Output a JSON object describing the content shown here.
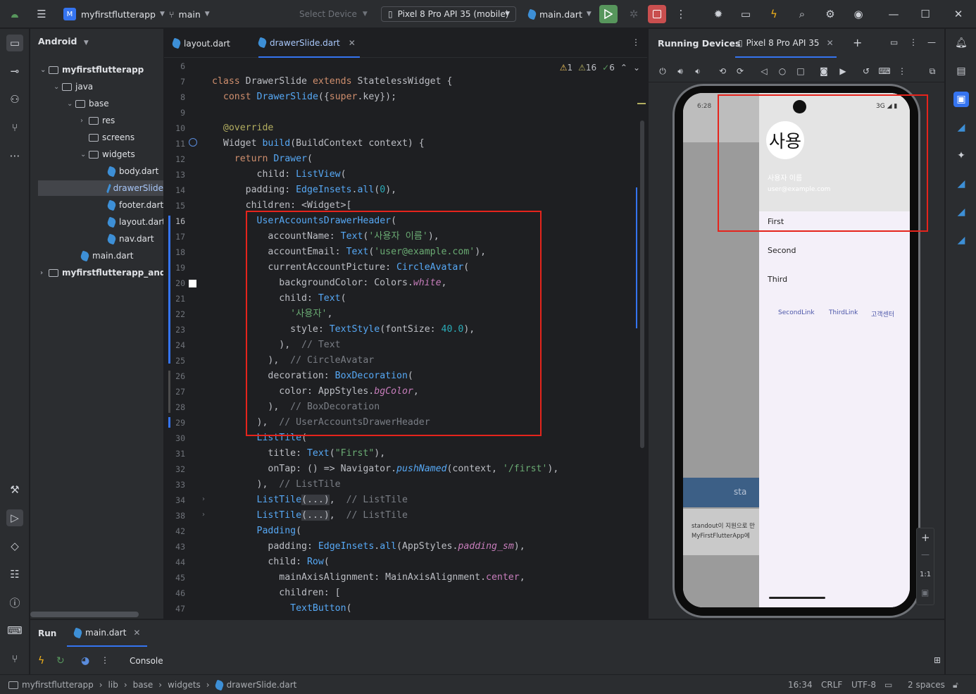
{
  "titlebar": {
    "project": "myfirstflutterapp",
    "project_badge": "M",
    "branch": "main",
    "select_device": "Select Device",
    "device": "Pixel 8 Pro API 35 (mobile)",
    "run_config": "main.dart"
  },
  "project_panel": {
    "header": "Android",
    "tree": [
      {
        "label": "myfirstflutterapp",
        "bold": true
      },
      {
        "label": "java"
      },
      {
        "label": "base"
      },
      {
        "label": "res"
      },
      {
        "label": "screens"
      },
      {
        "label": "widgets"
      },
      {
        "label": "body.dart"
      },
      {
        "label": "drawerSlide"
      },
      {
        "label": "footer.dart"
      },
      {
        "label": "layout.dart"
      },
      {
        "label": "nav.dart"
      },
      {
        "label": "main.dart"
      },
      {
        "label": "myfirstflutterapp_andro",
        "bold": true
      }
    ]
  },
  "editor": {
    "tabs": [
      {
        "label": "layout.dart"
      },
      {
        "label": "drawerSlide.dart",
        "active": true
      }
    ],
    "indicators": {
      "warnings": "1",
      "weak_warnings": "16",
      "typos": "6"
    },
    "line_numbers": [
      "6",
      "7",
      "8",
      "9",
      "10",
      "11",
      "12",
      "13",
      "14",
      "15",
      "16",
      "17",
      "18",
      "19",
      "20",
      "21",
      "22",
      "23",
      "24",
      "25",
      "26",
      "27",
      "28",
      "29",
      "30",
      "31",
      "32",
      "33",
      "34",
      "38",
      "42",
      "43",
      "44",
      "45",
      "46",
      "47"
    ]
  },
  "devices": {
    "title": "Running Devices",
    "tab": "Pixel 8 Pro API 35",
    "status_time": "6:28",
    "status_net": "3G",
    "avatar_text": "사용",
    "account_name": "사용자 이름",
    "account_email": "user@example.com",
    "menu": [
      "First",
      "Second",
      "Third"
    ],
    "links": [
      "SecondLink",
      "ThirdLink",
      "고객센터"
    ],
    "bg_text_1": "standout이 지원으로 만",
    "bg_text_2": "MyFirstFlutterApp에",
    "bg_banner": "sta",
    "zoom_label": "1:1"
  },
  "run_panel": {
    "run_label": "Run",
    "tab": "main.dart",
    "console": "Console"
  },
  "statusbar": {
    "breadcrumb": [
      "myfirstflutterapp",
      "lib",
      "base",
      "widgets",
      "drawerSlide.dart"
    ],
    "position": "16:34",
    "line_sep": "CRLF",
    "encoding": "UTF-8",
    "indent": "2 spaces"
  },
  "colors": {
    "accent": "#3574f0",
    "highlight_box": "#e5241c",
    "run_green": "#57965c",
    "stop_red": "#c94f4f"
  }
}
